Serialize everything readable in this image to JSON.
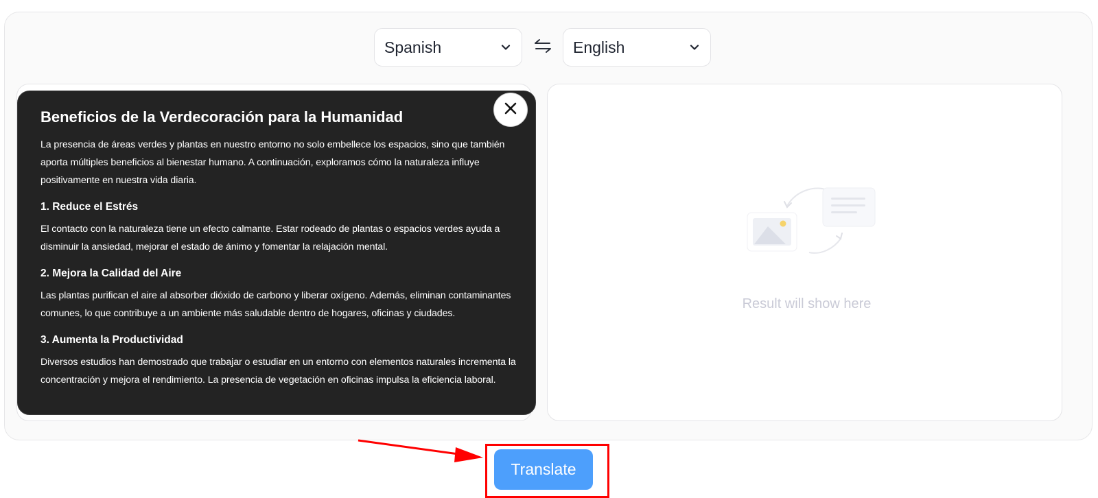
{
  "languages": {
    "source": "Spanish",
    "target": "English"
  },
  "document": {
    "title": "Beneficios de la Verdecoración para la Humanidad",
    "intro": "La presencia de áreas verdes y plantas en nuestro entorno no solo embellece los espacios, sino que también aporta múltiples beneficios al bienestar humano. A continuación, exploramos cómo la naturaleza influye positivamente en nuestra vida diaria.",
    "sections": [
      {
        "heading": "1. Reduce el Estrés",
        "body": "El contacto con la naturaleza tiene un efecto calmante. Estar rodeado de plantas o espacios verdes ayuda a disminuir la ansiedad, mejorar el estado de ánimo y fomentar la relajación mental."
      },
      {
        "heading": "2. Mejora la Calidad del Aire",
        "body": "Las plantas purifican el aire al absorber dióxido de carbono y liberar oxígeno. Además, eliminan contaminantes comunes, lo que contribuye a un ambiente más saludable dentro de hogares, oficinas y ciudades."
      },
      {
        "heading": "3. Aumenta la Productividad",
        "body": "Diversos estudios han demostrado que trabajar o estudiar en un entorno con elementos naturales incrementa la concentración y mejora el rendimiento. La presencia de vegetación en oficinas impulsa la eficiencia laboral."
      }
    ]
  },
  "output": {
    "placeholder": "Result will show here"
  },
  "actions": {
    "translate_label": "Translate"
  },
  "colors": {
    "accent": "#4d9ffc",
    "highlight": "#ff0000",
    "preview_bg": "#232323"
  },
  "icons": {
    "swap": "swap-arrows-icon",
    "chevron": "chevron-down-icon",
    "close": "close-icon",
    "placeholder": "image-to-document-illustration-icon"
  }
}
